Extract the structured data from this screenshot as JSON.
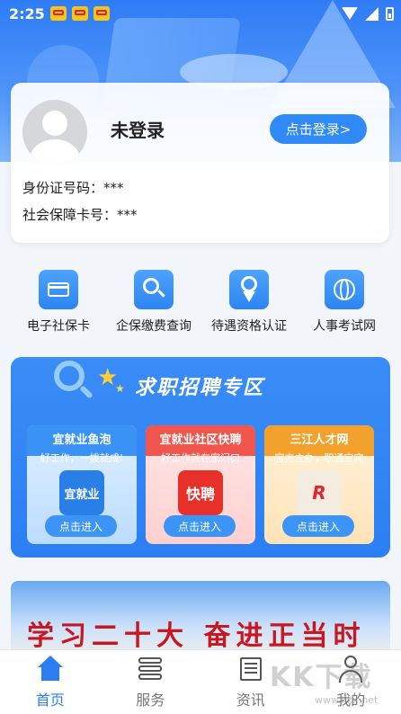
{
  "status_bar": {
    "time": "2:25"
  },
  "user": {
    "name": "未登录",
    "login_label": "点击登录>",
    "id_label": "身份证号码：***",
    "card_label": "社会保障卡号：***"
  },
  "services": [
    {
      "label": "电子社保卡",
      "icon": "card-icon"
    },
    {
      "label": "企保缴费查询",
      "icon": "search-icon"
    },
    {
      "label": "待遇资格认证",
      "icon": "award-icon"
    },
    {
      "label": "人事考试网",
      "icon": "globe-icon"
    }
  ],
  "recruit": {
    "title": "求职招聘专区",
    "cards": [
      {
        "title": "宜就业鱼泡",
        "subtitle": "好工作，一拨就成!",
        "logo": "宜就业",
        "button": "点击进入"
      },
      {
        "title": "宜就业社区快聘",
        "subtitle": "好工作就在家门口",
        "logo": "快聘",
        "button": "点击进入"
      },
      {
        "title": "三江人才网",
        "subtitle": "官方主办，职通宜宾",
        "logo": "R",
        "button": "点击进入"
      }
    ]
  },
  "banner": {
    "text": "学习二十大 奋进正当时"
  },
  "nav": [
    {
      "label": "首页",
      "icon": "home-icon"
    },
    {
      "label": "服务",
      "icon": "service-icon"
    },
    {
      "label": "资讯",
      "icon": "news-icon"
    },
    {
      "label": "我的",
      "icon": "user-icon"
    }
  ],
  "watermark": {
    "text": "KK下载",
    "sub": "www.kkx.net"
  },
  "colors": {
    "primary": "#2c7ef0",
    "login": "#2f8af5",
    "banner_text": "#c8171f"
  }
}
